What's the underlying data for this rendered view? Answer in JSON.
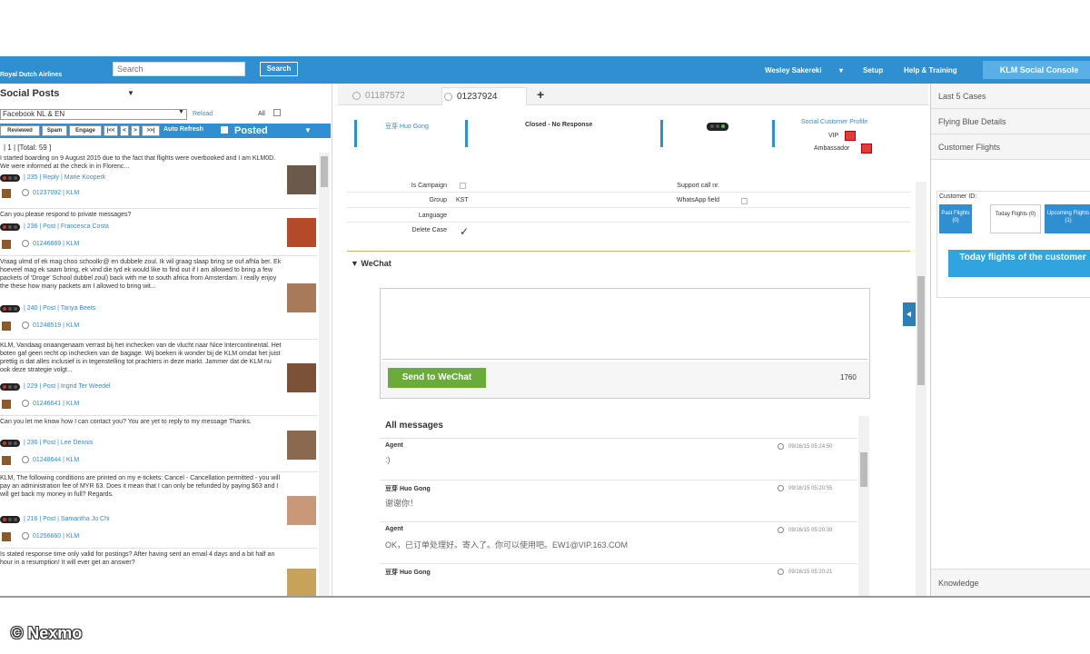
{
  "app": {
    "airline": "Royal Dutch Airlines",
    "search_placeholder": "Search",
    "search_button": "Search",
    "nav": [
      "Wesley Sakereki",
      "Setup",
      "Help & Training"
    ],
    "console_button": "KLM Social Console",
    "accent": "#2f8fd0"
  },
  "left": {
    "title": "Social Posts",
    "channel": "Facebook NL & EN",
    "reload": "Reload",
    "all": "All",
    "buttons": [
      "Reviewed",
      "Spam",
      "Engage",
      "|<<",
      "<",
      ">",
      ">>|"
    ],
    "auto_refresh": "Auto Refresh",
    "filter": "Posted",
    "total": "| 1 | [Total: 59 ]",
    "posts": [
      {
        "text": "I started boarding on 9 August 2015 due to the fact that flights were overbooked and I am KLM0D. We were informed at the check in in Florenc...",
        "meta": "| 235 | Reply | Marie Kooperk",
        "case": "01237092 | KLM"
      },
      {
        "text": "Can you please respond to private messages?",
        "meta": "| 236 | Post | Francesca Costa",
        "case": "01246669 | KLM"
      },
      {
        "text": "Vraag ulmd of ek mag choo schoolkr@ en dubbele zoul. Ik wil graag slaap bring se ouf afhla ber. Ek hoeveel mag ek saam bring, ek vind die tyd ek would like to find out if I am allowed to bring a few packets of 'Droge' School dubbel zoul) back with me to south africa from Amsterdam. I really enjoy the these how many packets am I allowed to bring wit...",
        "meta": "| 240 | Post | Tanya Beets",
        "case": "01248519 | KLM"
      },
      {
        "text": "KLM, Vandaag onaangenaam verrast bij het inchecken van de vlucht naar Nice Intercontinental. Het boten gaf geen recht op inchecken van de bagage. Wij boeken ik wonder bij de KLM omdat het juist prettig is dat alles inclusief is in tegenstelling tot prachters in deze markt. Jammer dat de KLM nu ook deze strategie volgt...",
        "meta": "| 229 | Post | Ingrid Ter Weedel",
        "case": "01246641 | KLM"
      },
      {
        "text": "Can you let me know how I can contact you? You are yet to reply to my message Thanks.",
        "meta": "| 236 | Post | Lee Dennis",
        "case": "01248644 | KLM"
      },
      {
        "text": "KLM, The following conditions are printed on my e-tickets: Cancel - Cancellation permitted - you will pay an administration fee of MYR 63. Does it mean that I can only be refunded by paying $63 and I will get back my money in full? Regards.",
        "meta": "| 216 | Post | Samantha Jo Chi",
        "case": "01256660 | KLM"
      },
      {
        "text": "Is stated response time only valid for postings? After having sent an email 4 days and a bit half an hour in a resumption! It will ever get an answer?",
        "meta": "",
        "case": ""
      }
    ]
  },
  "tabs": [
    "01187572",
    "01237924"
  ],
  "case": {
    "user": "豆芽 Huo Gong",
    "status": "Closed - No Response",
    "profile": "Social Customer Profile",
    "vip": "VIP",
    "ambassador": "Ambassador"
  },
  "form": {
    "rows": [
      {
        "label": "Is Campaign",
        "value": ""
      },
      {
        "label": "Group",
        "value": "KST"
      },
      {
        "label": "Language",
        "value": ""
      },
      {
        "label": "Delete Case",
        "value": "✓"
      }
    ],
    "right_rows": [
      {
        "label": "Support call nr.",
        "value": ""
      },
      {
        "label": "WhatsApp field",
        "value": ""
      }
    ]
  },
  "wechat": {
    "section": "WeChat",
    "send_button": "Send to WeChat",
    "char_count": "1760"
  },
  "messages": {
    "header": "All messages",
    "items": [
      {
        "from": "Agent",
        "body": ":)",
        "time": "09/16/15 05:24:50"
      },
      {
        "from": "豆芽 Huo Gong",
        "body": "谢谢你！",
        "time": "09/16/15 05:20:55"
      },
      {
        "from": "Agent",
        "body": "OK，已订单处理好。寄入了。你可以使用吧。EW1@VIP.163.COM",
        "time": "09/16/15 05:20:39"
      },
      {
        "from": "豆芽 Huo Gong",
        "body": "",
        "time": "09/16/15 05:20:21"
      }
    ]
  },
  "right": {
    "accordion": [
      "Last 5 Cases",
      "Flying Blue Details",
      "Customer Flights"
    ],
    "customer_id_label": "Customer ID:",
    "flight_tabs": [
      "Past Flights (0)",
      "Today Flights (0)",
      "Upcoming Flights (1)"
    ],
    "today_button": "Today flights of the customer",
    "knowledge": "Knowledge"
  },
  "watermark": "© Nexmo"
}
